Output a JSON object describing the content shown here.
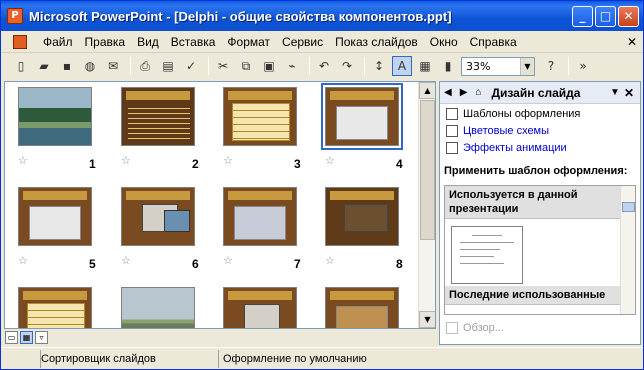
{
  "window": {
    "title": "Microsoft PowerPoint - [Delphi - общие свойства компонентов.ppt]",
    "app_icon": "P"
  },
  "menu": [
    "Файл",
    "Правка",
    "Вид",
    "Вставка",
    "Формат",
    "Сервис",
    "Показ слайдов",
    "Окно",
    "Справка"
  ],
  "toolbar": {
    "zoom": "33%"
  },
  "slides": [
    {
      "num": "1"
    },
    {
      "num": "2"
    },
    {
      "num": "3"
    },
    {
      "num": "4"
    },
    {
      "num": "5"
    },
    {
      "num": "6"
    },
    {
      "num": "7"
    },
    {
      "num": "8"
    }
  ],
  "task_pane": {
    "title": "Дизайн слайда",
    "links": [
      "Шаблоны оформления",
      "Цветовые схемы",
      "Эффекты анимации"
    ],
    "apply_label": "Применить шаблон оформления:",
    "gallery_used": "Используется в данной презентации",
    "gallery_recent": "Последние использованные",
    "browse": "Обзор..."
  },
  "status": {
    "view": "Сортировщик слайдов",
    "design": "Оформление по умолчанию"
  }
}
